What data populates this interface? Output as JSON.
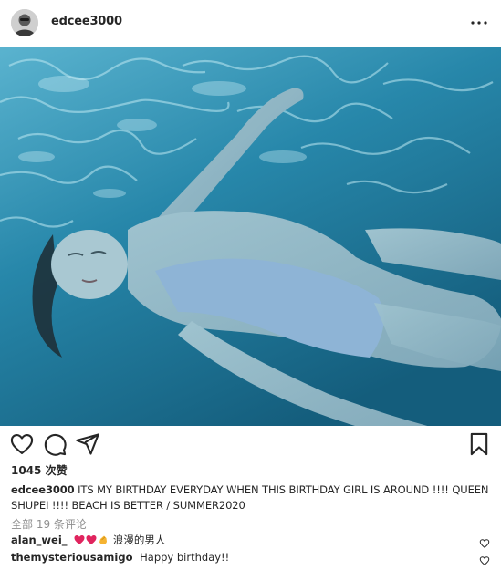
{
  "header": {
    "username": "edcee3000",
    "more_icon": "more-horizontal-icon"
  },
  "actions": {
    "like_icon": "heart-icon",
    "comment_icon": "comment-icon",
    "share_icon": "share-icon",
    "save_icon": "bookmark-icon"
  },
  "likes_text": "1045 次赞",
  "caption": {
    "username": "edcee3000",
    "text": "ITS MY BIRTHDAY EVERYDAY WHEN THIS BIRTHDAY GIRL IS AROUND !!!! QUEEN SHUPEI !!!! BEACH IS BETTER / SUMMER2020"
  },
  "view_all_comments": "全部 19 条评论",
  "comments": [
    {
      "username": "alan_wei_",
      "text": "浪漫的男人",
      "emojis": [
        "heart-emoji",
        "heart-emoji",
        "clapping-hands-emoji"
      ]
    },
    {
      "username": "themysteriousamigo",
      "text": "Happy birthday!!"
    }
  ],
  "colors": {
    "text": "#262626",
    "muted": "#8e8e8e",
    "emoji_heart": "#e0245e",
    "emoji_clap": "#f5b331"
  }
}
